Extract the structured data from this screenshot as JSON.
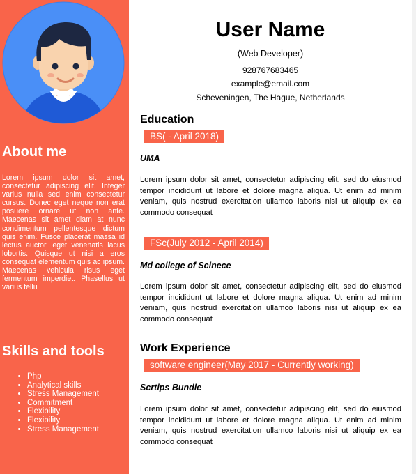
{
  "colors": {
    "accent": "#f9644a",
    "avatar_bg": "#4a8ff7"
  },
  "profile": {
    "name": "User Name",
    "role": "(Web Developer)",
    "phone": "928767683465",
    "email": "example@email.com",
    "address": "Scheveningen, The Hague, Netherlands"
  },
  "sidebar": {
    "avatar_icon": "user-avatar-icon",
    "about_title": "About me",
    "about_text": "Lorem ipsum dolor sit amet, consectetur adipiscing elit. Integer varius nulla sed enim consectetur cursus. Donec eget neque non erat posuere ornare ut non ante. Maecenas sit amet diam at nunc condimentum pellentesque dictum quis enim. Fusce placerat massa id lectus auctor, eget venenatis lacus lobortis. Quisque ut nisi a eros consequat elementum quis ac ipsum. Maecenas vehicula risus eget fermentum imperdiet. Phasellus ut varius tellu",
    "skills_title": "Skills and tools",
    "skills": [
      "Php",
      "Analytical skills",
      "Stress Management",
      "Commitment",
      "Flexibility",
      "Flexibility",
      "Stress Management"
    ]
  },
  "education": {
    "title": "Education",
    "entries": [
      {
        "period": "BS( - April 2018)",
        "institution": "UMA",
        "description": "Lorem ipsum dolor sit amet, consectetur adipiscing elit, sed do eiusmod tempor incididunt ut labore et dolore magna aliqua. Ut enim ad minim veniam, quis nostrud exercitation ullamco laboris nisi ut aliquip ex ea commodo consequat"
      },
      {
        "period": "FSc(July 2012 - April 2014)",
        "institution": "Md college of Scinece",
        "description": "Lorem ipsum dolor sit amet, consectetur adipiscing elit, sed do eiusmod tempor incididunt ut labore et dolore magna aliqua. Ut enim ad minim veniam, quis nostrud exercitation ullamco laboris nisi ut aliquip ex ea commodo consequat"
      }
    ]
  },
  "work": {
    "title": "Work Experience",
    "entries": [
      {
        "period": "software engineer(May 2017 - Currently working)",
        "company": "Scrtips Bundle",
        "description": "Lorem ipsum dolor sit amet, consectetur adipiscing elit, sed do eiusmod tempor incididunt ut labore et dolore magna aliqua. Ut enim ad minim veniam, quis nostrud exercitation ullamco laboris nisi ut aliquip ex ea commodo consequat"
      }
    ]
  }
}
